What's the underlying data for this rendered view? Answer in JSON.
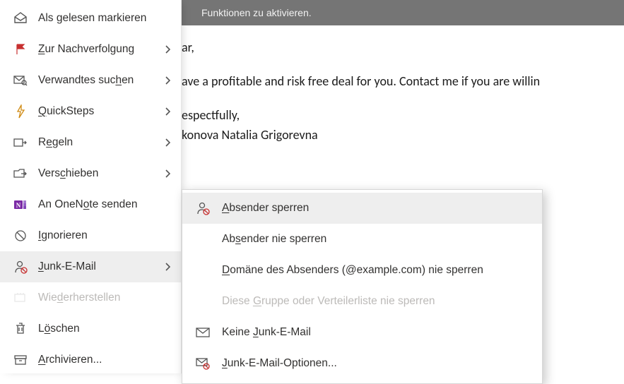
{
  "notification": {
    "text": "Funktionen zu aktivieren."
  },
  "email": {
    "greeting_fragment": "ar,",
    "body_fragment": "ave a profitable and risk free deal for you. Contact me if you are willin",
    "closing_fragment": "espectfully,",
    "sender_fragment": "konova Natalia Grigorevna"
  },
  "menu": {
    "mark_read": "Als gelesen markieren",
    "follow_up": "Zur Nachverfolgung",
    "related_search": "Verwandtes suchen",
    "quick_steps": "QuickSteps",
    "rules": "Regeln",
    "move": "Verschieben",
    "onenote": "An OneNote senden",
    "ignore": "Ignorieren",
    "junk": "Junk-E-Mail",
    "restore": "Wiederherstellen",
    "delete": "Löschen",
    "archive": "Archivieren..."
  },
  "submenu": {
    "block_sender": "Absender sperren",
    "never_block_sender": "Absender nie sperren",
    "never_block_domain": "Domäne des Absenders (@example.com) nie sperren",
    "never_block_group": "Diese Gruppe oder Verteilerliste nie sperren",
    "not_junk": "Keine Junk-E-Mail",
    "junk_options": "Junk-E-Mail-Optionen..."
  }
}
